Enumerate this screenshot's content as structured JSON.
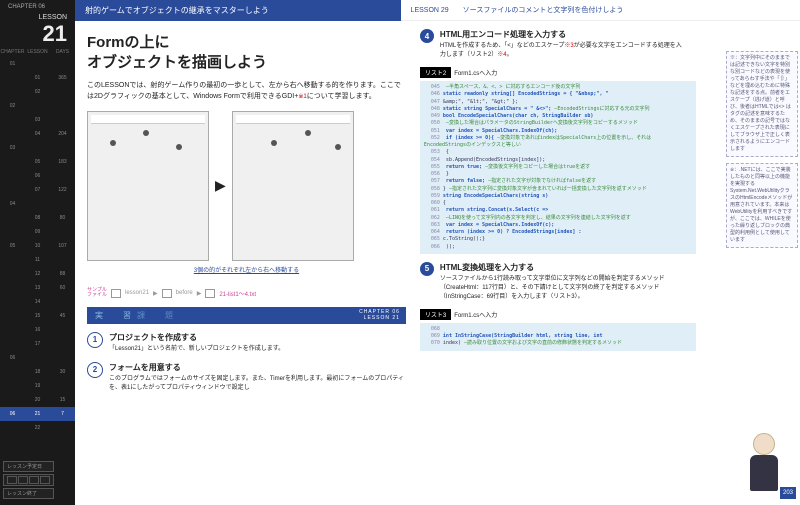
{
  "sidebar": {
    "chapter": "CHAPTER 06",
    "lesson_lbl": "LESSON",
    "lesson_num": "21",
    "cols": [
      "CHAPTER",
      "LESSON",
      "DAYS"
    ],
    "rows": [
      [
        "01",
        "",
        ""
      ],
      [
        "",
        "01",
        "365"
      ],
      [
        "",
        "02",
        ""
      ],
      [
        "02",
        "",
        ""
      ],
      [
        "",
        "03",
        ""
      ],
      [
        "",
        "04",
        "204"
      ],
      [
        "03",
        "",
        ""
      ],
      [
        "",
        "05",
        "183"
      ],
      [
        "",
        "06",
        ""
      ],
      [
        "",
        "07",
        "122"
      ],
      [
        "04",
        "",
        ""
      ],
      [
        "",
        "08",
        "80"
      ],
      [
        "",
        "09",
        ""
      ],
      [
        "05",
        "10",
        "107"
      ],
      [
        "",
        "11",
        ""
      ],
      [
        "",
        "12",
        "88"
      ],
      [
        "",
        "13",
        "60"
      ],
      [
        "",
        "14",
        ""
      ],
      [
        "",
        "15",
        "45"
      ],
      [
        "",
        "16",
        ""
      ],
      [
        "",
        "17",
        ""
      ],
      [
        "06",
        "",
        ""
      ],
      [
        "",
        "18",
        "30"
      ],
      [
        "",
        "19",
        ""
      ],
      [
        "",
        "20",
        "15"
      ],
      [
        "06",
        "21",
        "7"
      ],
      [
        "",
        "22",
        ""
      ],
      [
        "",
        "23",
        ""
      ],
      [
        "",
        "24",
        ""
      ],
      [
        "",
        "25",
        ""
      ],
      [
        "",
        "26",
        ""
      ],
      [
        "07",
        "",
        ""
      ],
      [
        "",
        "27",
        ""
      ],
      [
        "",
        "28",
        ""
      ],
      [
        "",
        "29",
        ""
      ],
      [
        "",
        "30",
        ""
      ],
      [
        "",
        "31",
        ""
      ],
      [
        "",
        "32",
        ""
      ],
      [
        "08",
        "",
        ""
      ],
      [
        "",
        "33",
        ""
      ],
      [
        "",
        "34",
        ""
      ],
      [
        "09",
        "",
        ""
      ],
      [
        "",
        "35",
        ""
      ],
      [
        "",
        "36",
        ""
      ],
      [
        "10",
        "",
        ""
      ],
      [
        "",
        "37",
        ""
      ],
      [
        "",
        "38",
        ""
      ]
    ],
    "cur": 25,
    "bot1": "レッスン予定日",
    "bot2": "レッスン終了"
  },
  "hdr": {
    "l": "射的ゲームでオブジェクトの継承をマスターしよう",
    "r": "LESSON 29　　ソースファイルのコメントと文字列を色付けしよう"
  },
  "left": {
    "h1a": "Formの上に",
    "h1b": "オブジェクトを描画しよう",
    "intro": "このLESSONでは、射的ゲーム作りの最初の一歩として、左から右へ移動する的を作ります。ここでは2Dグラフィックの基本として、Windows Formで利用できるGDI+",
    "sup": "※1",
    "intro2": "について学習します。",
    "shot_t": "Form1",
    "cap": "3個の的がそれぞれ左から右へ移動する",
    "sf": {
      "lbl": "サンプル\nファイル",
      "p1": "lesson21",
      "p2": "before",
      "fn": "21-list1〜4.txt"
    },
    "prac": "実　習",
    "prac_sub": "課　題",
    "tag": "CHAPTER 06\nLESSON 21",
    "s1": {
      "t": "プロジェクトを作成する",
      "d": "「Lesson21」という名前で、新しいプロジェクトを作成します。"
    },
    "s2": {
      "t": "フォームを用意する",
      "d": "このプログラムではフォームのサイズを固定します。また、Timerを利用します。最初にフォームのプロパティを、表1にしたがってプロパティウィンドウで設定し"
    }
  },
  "right": {
    "s4": {
      "t": "HTML用エンコード処理を入力する",
      "d": "HTMLを作成するため、「<」などのエスケープ",
      "sup": "※3",
      "d2": "が必要な文字をエンコードする処理を入力します（リスト2）",
      "sup2": "※4",
      "d3": "。"
    },
    "l2": {
      "tag": "リスト2",
      "fn": "Form1.csへ入力"
    },
    "code2": [
      {
        "n": "045",
        "t": "",
        "c": "半角スペース、&、<、> に対応するエンコード後の文字列"
      },
      {
        "n": "046",
        "t": "static readonly string[] EncodedStrings = { \"&nbsp;\", \"",
        "k": 1
      },
      {
        "n": "047",
        "t": "&amp;\", \"&lt;\", \"&gt;\" };"
      },
      {
        "n": "048",
        "t": "static string SpecialChars = \" &<>\";",
        "k": 1,
        "c": "EncodedStringsに対応する元の文字列"
      },
      {
        "n": "049",
        "t": "bool EncodeSpecialChars(char ch, StringBuilder sb)",
        "k": 1
      },
      {
        "n": "050",
        "t": "",
        "c": "変換した場合はパラメータのStringBuilderへ変換後文字列をコピーするメソッド"
      },
      {
        "n": "051",
        "t": "  var index = SpecialChars.IndexOf(ch);",
        "k": 1
      },
      {
        "n": "052",
        "t": "  if (index >= 0){",
        "k": 1,
        "c": "変換対象であればindexはSpecialChars上の位置を示し、それはEncodedStringsのインデックスと等しい"
      },
      {
        "n": "053",
        "t": "  {"
      },
      {
        "n": "054",
        "t": "    sb.Append(EncodedStrings[index]);"
      },
      {
        "n": "055",
        "t": "    return true;",
        "k": 1,
        "c": "変換後文字列をコピーした場合はtrueを返す"
      },
      {
        "n": "056",
        "t": "  }"
      },
      {
        "n": "057",
        "t": "  return false;",
        "k": 1,
        "c": "指定された文字が対象でなければfalseを返す"
      },
      {
        "n": "058",
        "t": "}",
        "c": "指定された文字列に変換対象文字が含まれていれば一括変換した文字列を返すメソッド"
      },
      {
        "n": "059",
        "t": "string EncodeSpecialChars(string s)",
        "k": 1
      },
      {
        "n": "060",
        "t": "{"
      },
      {
        "n": "061",
        "t": "  return string.Concat(s.Select(c =>",
        "k": 1
      },
      {
        "n": "062",
        "t": "",
        "c": "LINQを使って文字列内の各文字を判定し、結果の文字列を連結した文字列を返す"
      },
      {
        "n": "063",
        "t": "    var index = SpecialChars.IndexOf(c);",
        "k": 1
      },
      {
        "n": "064",
        "t": "    return (index >= 0) ? EncodedStrings[index] :",
        "k": 1
      },
      {
        "n": "065",
        "t": "c.ToString();}"
      },
      {
        "n": "066",
        "t": "  ));"
      }
    ],
    "s5": {
      "t": "HTML変換処理を入力する",
      "d": "ソースファイルから1行読み取って文字単位に文字列などの開始を判定するメソッド（CreateHtml：117行目）と、その下請けとして文字列の終了を判定するメソッド（InStringCase：69行目）を入力します（リスト3）。"
    },
    "l3": {
      "tag": "リスト3",
      "fn": "Form1.csへ入力"
    },
    "code3": [
      {
        "n": "068",
        "t": ""
      },
      {
        "n": "069",
        "t": "int InStringCase(StringBuilder html, string line, int",
        "k": 1
      },
      {
        "n": "070",
        "t": "index)",
        "c": "読み取り位置の文字および文字の直前の修飾状態を判定するメソッド"
      }
    ],
    "n1": "※：文字列中にそのままでは記述できない文字を特別な別コードなどの表現を使ってあらわす手法や「｛｝」などを埋め込むために特殊な記述をする点。前者をエスケープ（逃げ道）と呼び、後者はHTMLでは<> はタグの記述を意味するため、そのままの記号ではなくエスケープされた表現にしてブラウザ上で正しく表示されるようにエンコードします",
    "n2": "※：.NETには、ここで実装したものと同等以上の機能を実現するSystem.Net.WebUtilityクラスのHtmlEncodeメソッドが用意されています。本来はWebUtilityを利用すべきですが、ここでは、WHILEを使った繰り返しブロックの典型的利用例として使用しています",
    "pnum": "203"
  }
}
